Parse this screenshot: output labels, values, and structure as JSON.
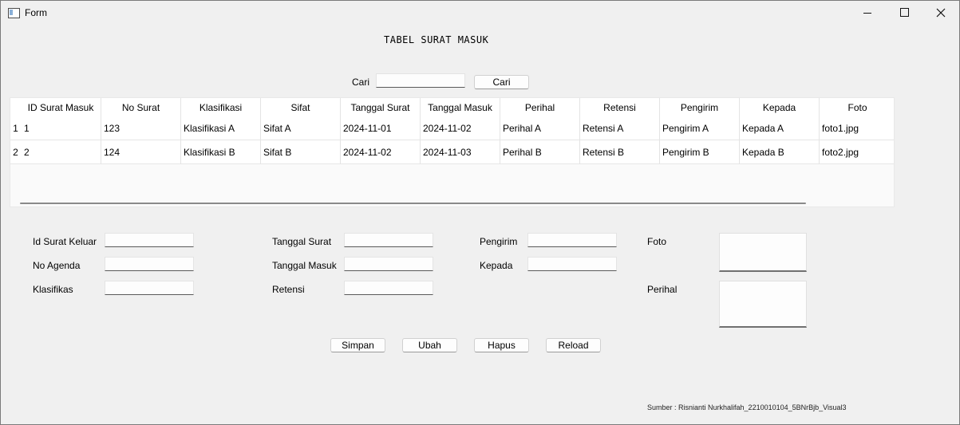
{
  "window": {
    "title": "Form",
    "minimize": "minimize",
    "maximize": "maximize",
    "close": "close"
  },
  "heading": "TABEL SURAT MASUK",
  "search": {
    "label": "Cari",
    "value": "",
    "button": "Cari"
  },
  "table": {
    "columns": [
      "ID Surat Masuk",
      "No Surat",
      "Klasifikasi",
      "Sifat",
      "Tanggal Surat",
      "Tanggal Masuk",
      "Perihal",
      "Retensi",
      "Pengirim",
      "Kepada",
      "Foto"
    ],
    "rows": [
      {
        "num": "1",
        "cells": [
          "1",
          "123",
          "Klasifikasi A",
          "Sifat A",
          "2024-11-01",
          "2024-11-02",
          "Perihal A",
          "Retensi A",
          "Pengirim A",
          "Kepada A",
          "foto1.jpg"
        ]
      },
      {
        "num": "2",
        "cells": [
          "2",
          "124",
          "Klasifikasi B",
          "Sifat B",
          "2024-11-02",
          "2024-11-03",
          "Perihal B",
          "Retensi B",
          "Pengirim B",
          "Kepada B",
          "foto2.jpg"
        ]
      }
    ]
  },
  "form": {
    "id_surat_keluar": {
      "label": "Id Surat Keluar",
      "value": ""
    },
    "no_agenda": {
      "label": "No Agenda",
      "value": ""
    },
    "klasifikasi": {
      "label": "Klasifikas",
      "value": ""
    },
    "tanggal_surat": {
      "label": "Tanggal Surat",
      "value": ""
    },
    "tanggal_masuk": {
      "label": "Tanggal Masuk",
      "value": ""
    },
    "retensi": {
      "label": "Retensi",
      "value": ""
    },
    "pengirim": {
      "label": "Pengirim",
      "value": ""
    },
    "kepada": {
      "label": "Kepada",
      "value": ""
    },
    "foto": {
      "label": "Foto",
      "value": ""
    },
    "perihal": {
      "label": "Perihal",
      "value": ""
    }
  },
  "buttons": {
    "simpan": "Simpan",
    "ubah": "Ubah",
    "hapus": "Hapus",
    "reload": "Reload"
  },
  "footer": "Sumber : Risnianti Nurkhalifah_2210010104_5BNrBjb_Visual3"
}
